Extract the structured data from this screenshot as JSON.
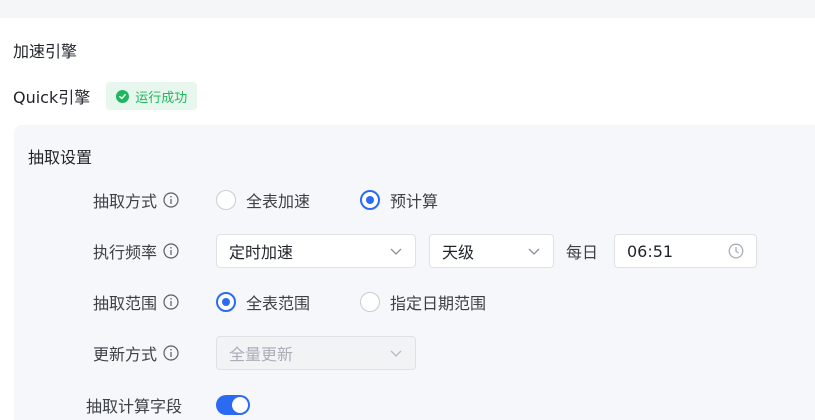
{
  "section": {
    "title": "加速引擎"
  },
  "engine": {
    "label": "Quick引擎",
    "status": "运行成功",
    "status_color": "#1fb660"
  },
  "panel": {
    "title": "抽取设置",
    "extract_mode": {
      "label": "抽取方式",
      "options": [
        "全表加速",
        "预计算"
      ],
      "selected": "预计算"
    },
    "frequency": {
      "label": "执行频率",
      "mode": "定时加速",
      "level": "天级",
      "every_label": "每日",
      "time": "06:51"
    },
    "range": {
      "label": "抽取范围",
      "options": [
        "全表范围",
        "指定日期范围"
      ],
      "selected": "全表范围"
    },
    "update": {
      "label": "更新方式",
      "value": "全量更新"
    },
    "calc_fields": {
      "label": "抽取计算字段",
      "enabled": true
    }
  },
  "colors": {
    "accent": "#2b6bf3",
    "panel_bg": "#f5f7fa"
  }
}
